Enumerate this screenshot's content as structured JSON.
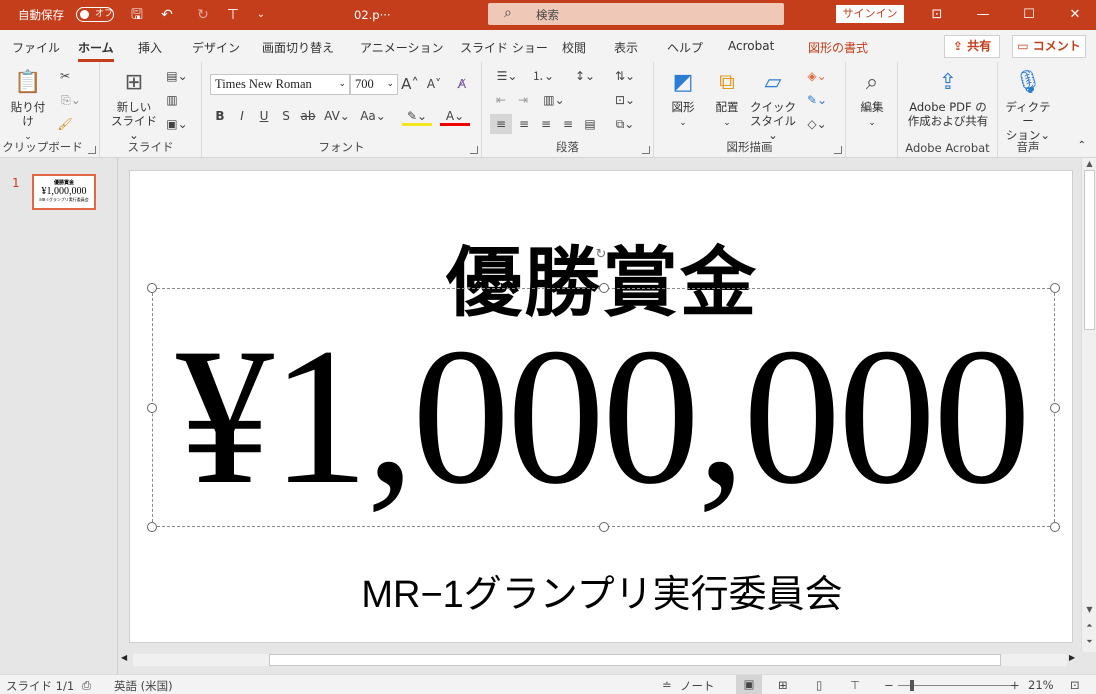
{
  "titlebar": {
    "autosave_label": "自動保存",
    "autosave_state": "オフ",
    "filename": "02.p···",
    "search_placeholder": "検索",
    "signin_label": "サインイン"
  },
  "tabs": [
    "ファイル",
    "ホーム",
    "挿入",
    "デザイン",
    "画面切り替え",
    "アニメーション",
    "スライド ショー",
    "校閲",
    "表示",
    "ヘルプ",
    "Acrobat",
    "図形の書式"
  ],
  "active_tab": "ホーム",
  "share_label": "共有",
  "comment_label": "コメント",
  "ribbon": {
    "clipboard": {
      "paste": "貼り付け",
      "group": "クリップボード"
    },
    "slides": {
      "new_slide_1": "新しい",
      "new_slide_2": "スライド",
      "group": "スライド"
    },
    "font": {
      "name": "Times New Roman",
      "size": "700",
      "group": "フォント"
    },
    "paragraph": {
      "group": "段落"
    },
    "drawing": {
      "shapes": "図形",
      "arrange": "配置",
      "quick_1": "クイック",
      "quick_2": "スタイル",
      "group": "図形描画"
    },
    "editing": {
      "label": "編集"
    },
    "acrobat": {
      "label_1": "Adobe PDF の",
      "label_2": "作成および共有",
      "group": "Adobe Acrobat"
    },
    "voice": {
      "label_1": "ディクテー",
      "label_2": "ション",
      "group": "音声"
    }
  },
  "thumbnail": {
    "number": "1",
    "line1": "優勝賞金",
    "line2": "¥1,000,000",
    "line3": "MR-1グランプリ実行委員会"
  },
  "slide": {
    "title": "優勝賞金",
    "amount": "¥1,000,000",
    "organizer": "MR−1グランプリ実行委員会"
  },
  "status": {
    "slide_count": "スライド 1/1",
    "language": "英語 (米国)",
    "notes": "ノート",
    "zoom": "21%"
  },
  "colors": {
    "accent": "#c43e1c",
    "selection": "#e06842"
  }
}
